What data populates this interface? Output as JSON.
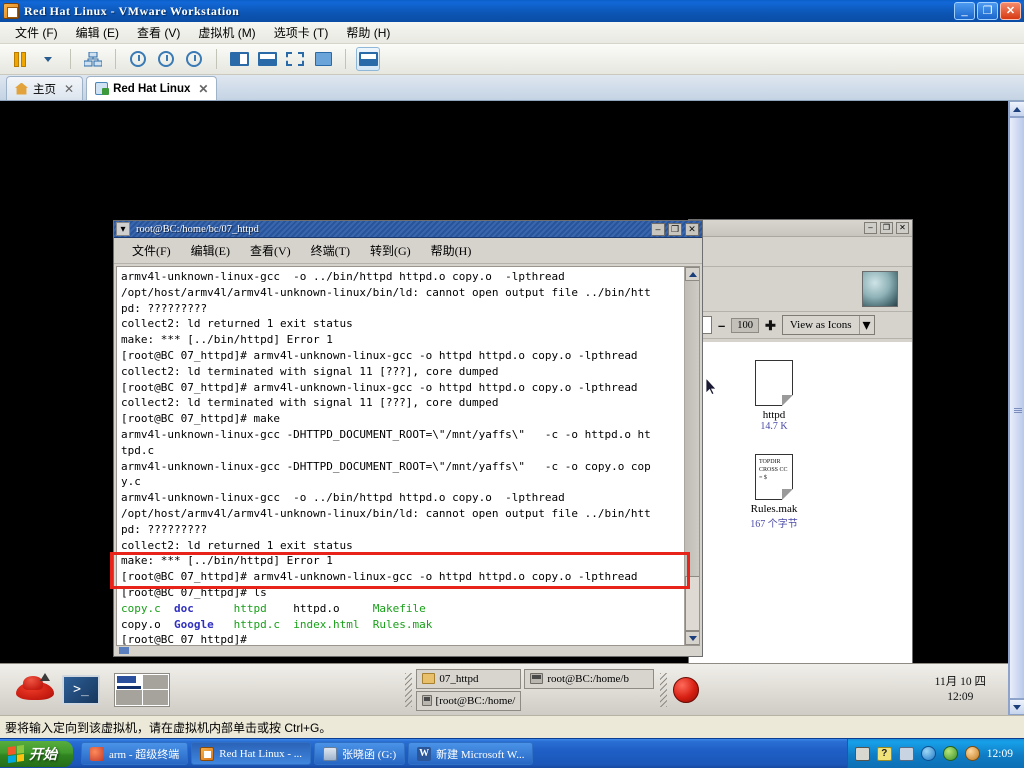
{
  "vmware": {
    "window_title": "Red Hat Linux - VMware Workstation",
    "window_controls": {
      "minimize": "_",
      "restore": "❐",
      "close": "✕"
    },
    "menus": [
      "文件 (F)",
      "编辑 (E)",
      "查看 (V)",
      "虚拟机 (M)",
      "选项卡 (T)",
      "帮助 (H)"
    ],
    "tabs": [
      {
        "label": "主页",
        "close": "✕"
      },
      {
        "label": "Red Hat Linux",
        "close": "✕"
      }
    ],
    "status_bar": "要将输入定向到该虚拟机，请在虚拟机内部单击或按 Ctrl+G。"
  },
  "terminal": {
    "title": "root@BC:/home/bc/07_httpd",
    "controls": {
      "minimize": "–",
      "maximize": "❐",
      "close": "✕"
    },
    "menus": [
      "文件(F)",
      "编辑(E)",
      "查看(V)",
      "终端(T)",
      "转到(G)",
      "帮助(H)"
    ],
    "lines": [
      "armv4l-unknown-linux-gcc  -o ../bin/httpd httpd.o copy.o  -lpthread",
      "/opt/host/armv4l/armv4l-unknown-linux/bin/ld: cannot open output file ../bin/htt",
      "pd: ?????????",
      "collect2: ld returned 1 exit status",
      "make: *** [../bin/httpd] Error 1",
      "[root@BC 07_httpd]# armv4l-unknown-linux-gcc -o httpd httpd.o copy.o -lpthread",
      "collect2: ld terminated with signal 11 [???], core dumped",
      "[root@BC 07_httpd]# armv4l-unknown-linux-gcc -o httpd httpd.o copy.o -lpthread",
      "collect2: ld terminated with signal 11 [???], core dumped",
      "[root@BC 07_httpd]# make",
      "armv4l-unknown-linux-gcc -DHTTPD_DOCUMENT_ROOT=\\\"/mnt/yaffs\\\"   -c -o httpd.o ht",
      "tpd.c",
      "armv4l-unknown-linux-gcc -DHTTPD_DOCUMENT_ROOT=\\\"/mnt/yaffs\\\"   -c -o copy.o cop",
      "y.c",
      "armv4l-unknown-linux-gcc  -o ../bin/httpd httpd.o copy.o  -lpthread",
      "/opt/host/armv4l/armv4l-unknown-linux/bin/ld: cannot open output file ../bin/htt",
      "pd: ?????????",
      "collect2: ld returned 1 exit status",
      "make: *** [../bin/httpd] Error 1",
      "[root@BC 07_httpd]# armv4l-unknown-linux-gcc -o httpd httpd.o copy.o -lpthread",
      "[root@BC 07_httpd]# ls"
    ],
    "ls_row1": [
      {
        "text": "copy.c",
        "color": "green"
      },
      {
        "text": "doc",
        "color": "blue"
      },
      {
        "text": "httpd",
        "color": "green"
      },
      {
        "text": "httpd.o",
        "color": "black"
      },
      {
        "text": "Makefile",
        "color": "green"
      }
    ],
    "ls_row2": [
      {
        "text": "copy.o",
        "color": "black"
      },
      {
        "text": "Google",
        "color": "blue"
      },
      {
        "text": "httpd.c",
        "color": "green"
      },
      {
        "text": "index.html",
        "color": "green"
      },
      {
        "text": "Rules.mak",
        "color": "green"
      }
    ],
    "prompt_last": "[root@BC 07_httpd]#",
    "highlight_color": "#e8231a"
  },
  "file_manager": {
    "controls": {
      "minimize": "–",
      "maximize": "❐",
      "close": "✕"
    },
    "zoom_value": "100",
    "zoom_out": "–",
    "zoom_in": "✚",
    "view_mode": "View as Icons",
    "view_dropdown": "▾",
    "files": [
      {
        "name": "httpd",
        "size": "14.7 K",
        "icon_text": ""
      },
      {
        "name": "Rules.mak",
        "size": "167 个字节",
        "icon_text": "TOPDIR\nCROSS\nCC = $"
      }
    ]
  },
  "gnome_panel": {
    "window_list": [
      {
        "label": "07_httpd",
        "icon": "folder-icon"
      },
      {
        "label": "root@BC:/home/b",
        "icon": "terminal-icon"
      },
      {
        "label": "[root@BC:/home/",
        "icon": "terminal-icon"
      }
    ],
    "clock_date": "11月 10 四",
    "clock_time": "12:09"
  },
  "xp_taskbar": {
    "start_label": "开始",
    "tasks": [
      {
        "label": "arm - 超级终端",
        "icon": "hyperterminal-icon",
        "active": false
      },
      {
        "label": "Red Hat Linux - ...",
        "icon": "vmware-icon",
        "active": true
      },
      {
        "label": "张晓函 (G:)",
        "icon": "drive-icon",
        "active": false
      },
      {
        "label": "新建 Microsoft W...",
        "icon": "word-icon",
        "active": false
      }
    ],
    "tray_icons": [
      "keyboard-icon",
      "help-icon",
      "network-icon",
      "security-shield-icon",
      "volume-icon",
      "messenger-icon"
    ],
    "clock": "12:09"
  }
}
